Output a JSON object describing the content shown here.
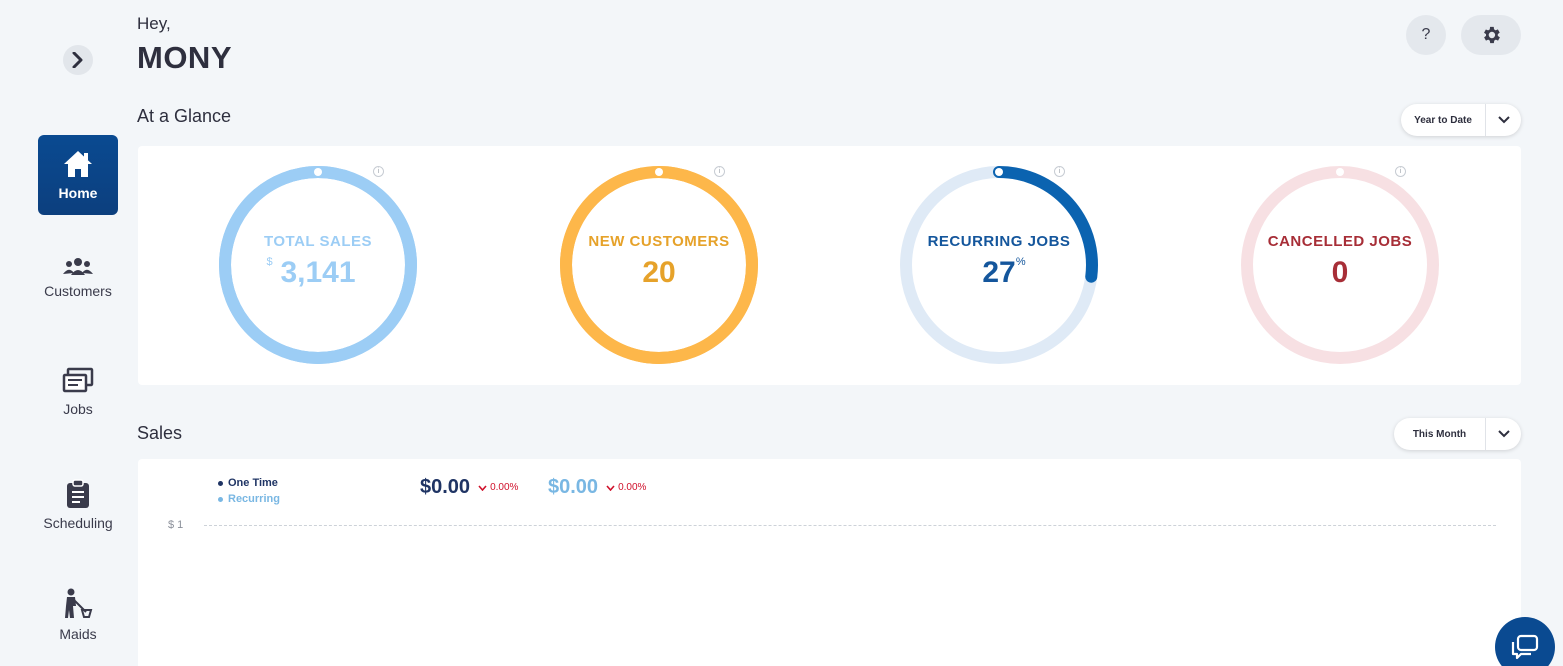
{
  "header": {
    "greeting": "Hey,",
    "username": "MONY",
    "help_label": "?"
  },
  "sidebar": {
    "items": [
      {
        "label": "Home",
        "icon": "home-icon",
        "active": true
      },
      {
        "label": "Customers",
        "icon": "customers-icon",
        "active": false
      },
      {
        "label": "Jobs",
        "icon": "jobs-icon",
        "active": false
      },
      {
        "label": "Scheduling",
        "icon": "clipboard-icon",
        "active": false
      },
      {
        "label": "Maids",
        "icon": "maid-icon",
        "active": false
      }
    ]
  },
  "glance": {
    "title": "At a Glance",
    "period": "Year to Date",
    "cards": [
      {
        "label": "TOTAL SALES",
        "prefix": "$",
        "value": "3,141",
        "suffix": "",
        "progress": 1.0,
        "color": "#9ccdf5",
        "track": "#9ccdf5",
        "text_color": "#9ccdf5",
        "value_color": "#9ccdf5"
      },
      {
        "label": "NEW CUSTOMERS",
        "prefix": "",
        "value": "20",
        "suffix": "",
        "progress": 0.97,
        "color": "#fdb74a",
        "track": "#fdb74a",
        "text_color": "#e6a22a",
        "value_color": "#e6a22a"
      },
      {
        "label": "RECURRING JOBS",
        "prefix": "",
        "value": "27",
        "suffix": "%",
        "progress": 0.27,
        "color": "#0b63b0",
        "track": "#dfeaf6",
        "text_color": "#14569c",
        "value_color": "#14569c"
      },
      {
        "label": "CANCELLED JOBS",
        "prefix": "",
        "value": "0",
        "suffix": "",
        "progress": 0,
        "color": "#b2333e",
        "track": "#f7e0e3",
        "text_color": "#a72e37",
        "value_color": "#a72e37"
      }
    ]
  },
  "sales": {
    "title": "Sales",
    "period": "This Month",
    "legend": [
      {
        "label": "One Time",
        "color": "#1f3464"
      },
      {
        "label": "Recurring",
        "color": "#79b7e3"
      }
    ],
    "stats": [
      {
        "amount": "$0.00",
        "change": "0.00%",
        "color": "#1f3464"
      },
      {
        "amount": "$0.00",
        "change": "0.00%",
        "color": "#79b7e3"
      }
    ],
    "y_tick": "$ 1"
  }
}
